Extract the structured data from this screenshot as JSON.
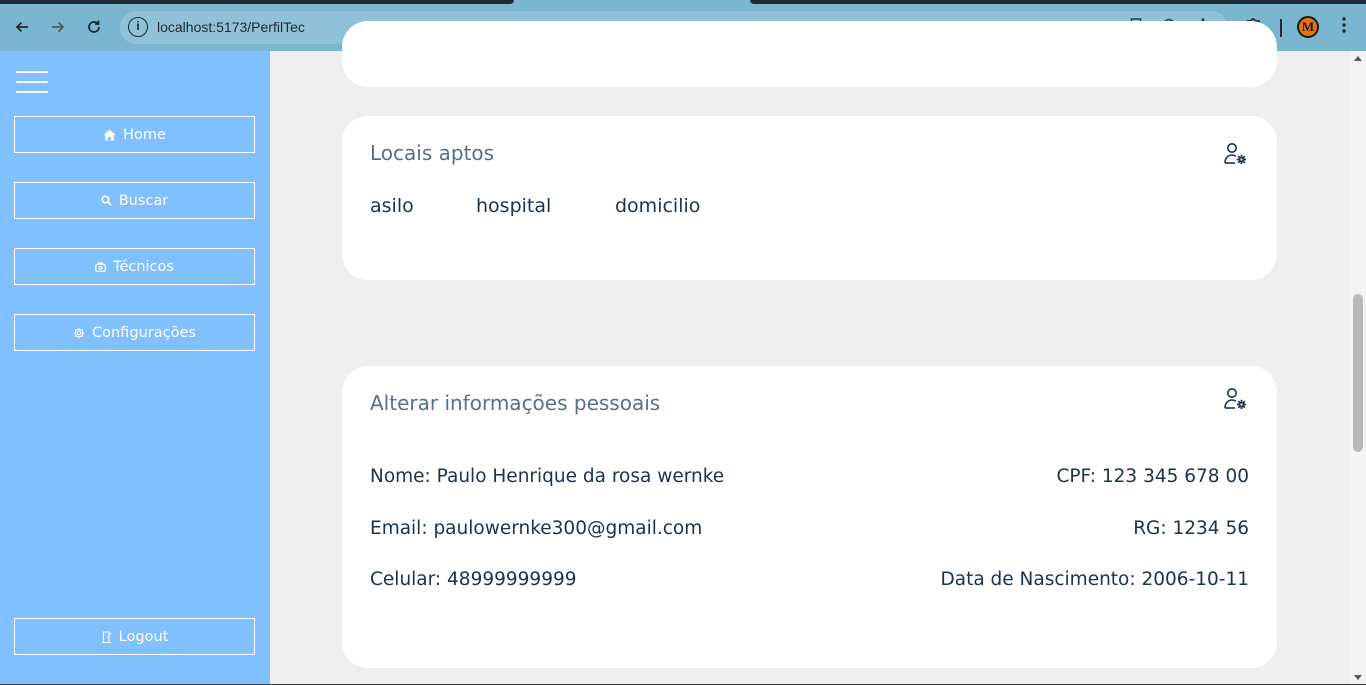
{
  "browser": {
    "url": "localhost:5173/PerfilTec",
    "back_icon": "arrow-left-icon",
    "forward_icon": "arrow-right-icon",
    "reload_icon": "reload-icon",
    "site_info_icon": "info-icon",
    "site_info_glyph": "i",
    "profile_initial": "M",
    "accent_color": "#7ab6d0"
  },
  "sidebar": {
    "background": "#81c0ff",
    "menu_icon": "hamburger-icon",
    "items": [
      {
        "label": "Home",
        "icon": "home-icon"
      },
      {
        "label": "Buscar",
        "icon": "search-icon"
      },
      {
        "label": "Técnicos",
        "icon": "tech-icon"
      },
      {
        "label": "Configurações",
        "icon": "gear-icon"
      }
    ],
    "logout": {
      "label": "Logout",
      "icon": "door-icon"
    }
  },
  "locais": {
    "title": "Locais aptos",
    "edit_icon": "user-gear-icon",
    "places": [
      "asilo",
      "hospital",
      "domicilio"
    ]
  },
  "pessoal": {
    "title": "Alterar informações pessoais",
    "edit_icon": "user-gear-icon",
    "nome": "Nome: Paulo Henrique da rosa wernke",
    "email": "Email: paulowernke300@gmail.com",
    "celular": "Celular: 48999999999",
    "cpf": "CPF: 123 345 678 00",
    "rg": "RG: 1234 56",
    "nascimento": "Data de Nascimento: 2006-10-11"
  }
}
